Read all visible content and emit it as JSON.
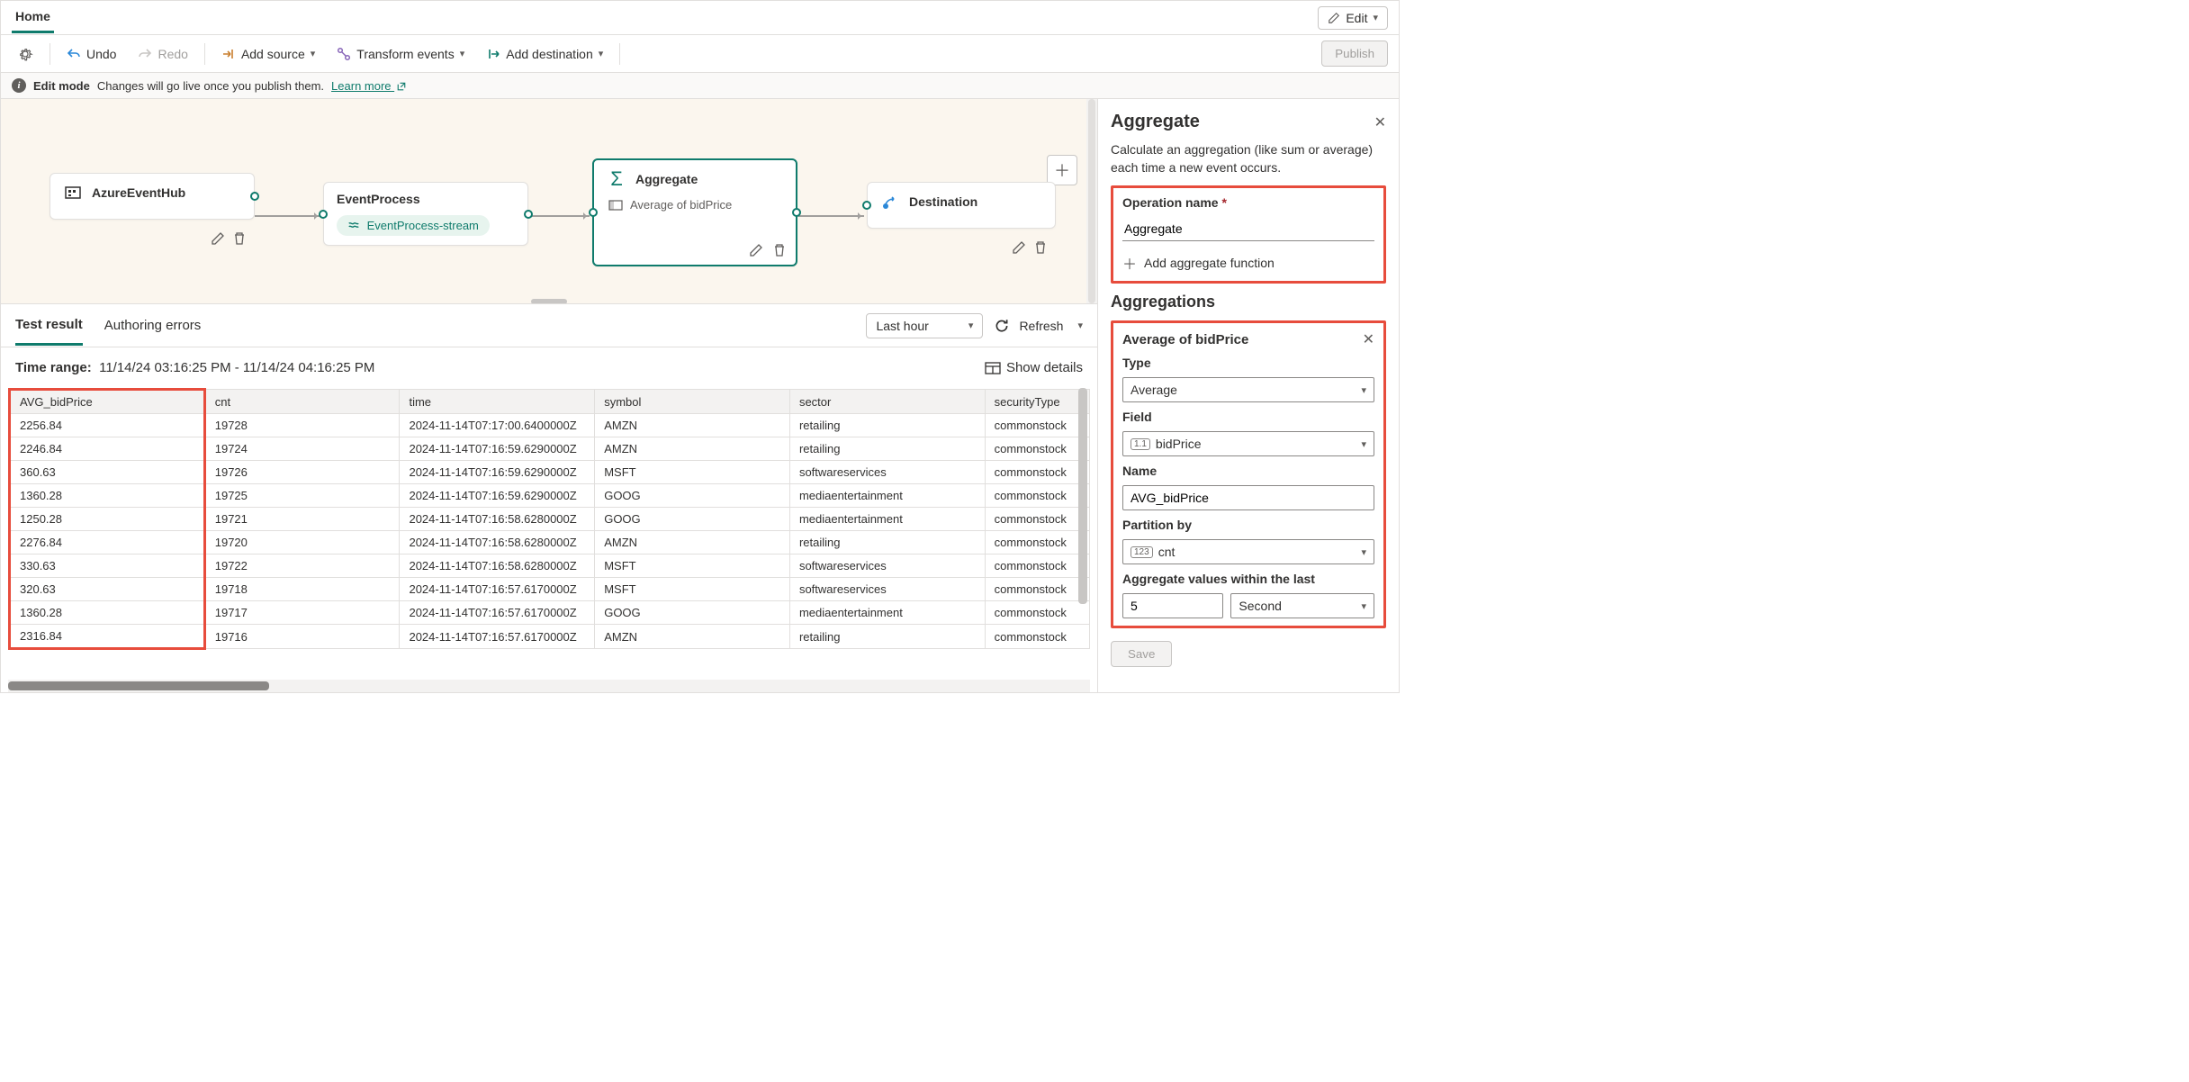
{
  "topTab": "Home",
  "editBtn": "Edit",
  "toolbar": {
    "undo": "Undo",
    "redo": "Redo",
    "addSource": "Add source",
    "transform": "Transform events",
    "addDest": "Add destination",
    "publish": "Publish"
  },
  "banner": {
    "title": "Edit mode",
    "msg": "Changes will go live once you publish them.",
    "learn": "Learn more"
  },
  "nodes": {
    "source": {
      "title": "AzureEventHub"
    },
    "process": {
      "title": "EventProcess",
      "pill": "EventProcess-stream"
    },
    "aggregate": {
      "title": "Aggregate",
      "sub": "Average of bidPrice"
    },
    "destination": {
      "title": "Destination"
    }
  },
  "results": {
    "tab1": "Test result",
    "tab2": "Authoring errors",
    "rangeDrop": "Last hour",
    "refresh": "Refresh",
    "timeRangeLabel": "Time range:",
    "timeRange": "11/14/24 03:16:25 PM - 11/14/24 04:16:25 PM",
    "showDetails": "Show details",
    "columns": [
      "AVG_bidPrice",
      "cnt",
      "time",
      "symbol",
      "sector",
      "securityType"
    ],
    "rows": [
      [
        "2256.84",
        "19728",
        "2024-11-14T07:17:00.6400000Z",
        "AMZN",
        "retailing",
        "commonstock"
      ],
      [
        "2246.84",
        "19724",
        "2024-11-14T07:16:59.6290000Z",
        "AMZN",
        "retailing",
        "commonstock"
      ],
      [
        "360.63",
        "19726",
        "2024-11-14T07:16:59.6290000Z",
        "MSFT",
        "softwareservices",
        "commonstock"
      ],
      [
        "1360.28",
        "19725",
        "2024-11-14T07:16:59.6290000Z",
        "GOOG",
        "mediaentertainment",
        "commonstock"
      ],
      [
        "1250.28",
        "19721",
        "2024-11-14T07:16:58.6280000Z",
        "GOOG",
        "mediaentertainment",
        "commonstock"
      ],
      [
        "2276.84",
        "19720",
        "2024-11-14T07:16:58.6280000Z",
        "AMZN",
        "retailing",
        "commonstock"
      ],
      [
        "330.63",
        "19722",
        "2024-11-14T07:16:58.6280000Z",
        "MSFT",
        "softwareservices",
        "commonstock"
      ],
      [
        "320.63",
        "19718",
        "2024-11-14T07:16:57.6170000Z",
        "MSFT",
        "softwareservices",
        "commonstock"
      ],
      [
        "1360.28",
        "19717",
        "2024-11-14T07:16:57.6170000Z",
        "GOOG",
        "mediaentertainment",
        "commonstock"
      ],
      [
        "2316.84",
        "19716",
        "2024-11-14T07:16:57.6170000Z",
        "AMZN",
        "retailing",
        "commonstock"
      ]
    ]
  },
  "panel": {
    "title": "Aggregate",
    "desc": "Calculate an aggregation (like sum or average) each time a new event occurs.",
    "opNameLabel": "Operation name",
    "opNameValue": "Aggregate",
    "addFn": "Add aggregate function",
    "aggsTitle": "Aggregations",
    "aggName": "Average of bidPrice",
    "typeLabel": "Type",
    "typeValue": "Average",
    "fieldLabel": "Field",
    "fieldValue": "bidPrice",
    "nameLabel": "Name",
    "nameValue": "AVG_bidPrice",
    "partitionLabel": "Partition by",
    "partitionValue": "cnt",
    "withinLabel": "Aggregate values within the last",
    "withinValue": "5",
    "withinUnit": "Second",
    "save": "Save"
  }
}
